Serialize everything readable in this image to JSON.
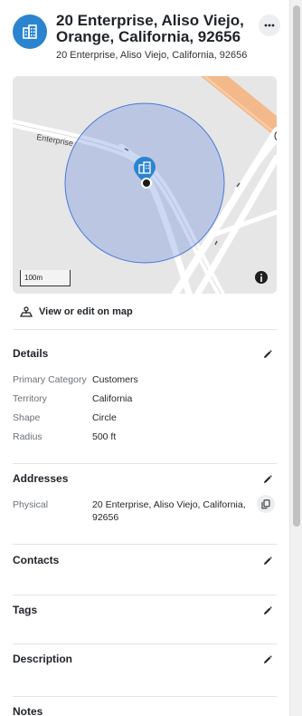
{
  "header": {
    "title": "20 Enterprise, Aliso Viejo, Orange, California, 92656",
    "subtitle": "20 Enterprise, Aliso Viejo, California, 92656",
    "avatar_icon": "building-icon",
    "more_icon": "more-horizontal-icon"
  },
  "map": {
    "street_label": "Enterprise",
    "scale_label": "100m",
    "info_icon": "info-icon",
    "pin_icon": "building-pin-icon",
    "circle_color": "#4a78d8"
  },
  "actions": {
    "view_edit_label": "View or edit on map",
    "view_edit_icon": "map-person-icon"
  },
  "details": {
    "title": "Details",
    "rows": [
      {
        "label": "Primary Category",
        "value": "Customers"
      },
      {
        "label": "Territory",
        "value": "California"
      },
      {
        "label": "Shape",
        "value": "Circle"
      },
      {
        "label": "Radius",
        "value": "500 ft"
      }
    ]
  },
  "addresses": {
    "title": "Addresses",
    "label": "Physical",
    "value": "20 Enterprise, Aliso Viejo, California, 92656",
    "copy_icon": "copy-icon"
  },
  "contacts": {
    "title": "Contacts"
  },
  "tags": {
    "title": "Tags"
  },
  "description": {
    "title": "Description"
  },
  "notes": {
    "title": "Notes"
  },
  "colors": {
    "accent": "#2b84d0",
    "road_orange": "#f4b98a"
  }
}
